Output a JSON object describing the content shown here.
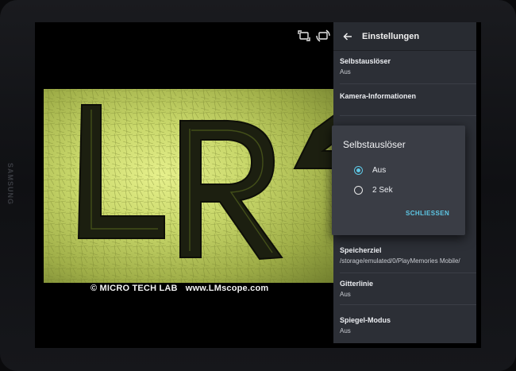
{
  "device": {
    "brand": "SAMSUNG"
  },
  "caption": {
    "copyright": "©  MICRO TECH LAB",
    "url": "www.LMscope.com"
  },
  "camera_controls": [
    {
      "name": "rotate-camera-icon"
    },
    {
      "name": "switch-camera-icon"
    }
  ],
  "settings": {
    "title": "Einstellungen",
    "items": [
      {
        "title": "Selbstauslöser",
        "value": "Aus"
      },
      {
        "title": "Kamera-Informationen",
        "value": ""
      },
      {
        "title": "Speicherziel",
        "value": "/storage/emulated/0/PlayMemories Mobile/"
      },
      {
        "title": "Gitterlinie",
        "value": "Aus"
      },
      {
        "title": "Spiegel-Modus",
        "value": "Aus"
      }
    ]
  },
  "dialog": {
    "title": "Selbstauslöser",
    "options": [
      {
        "label": "Aus",
        "selected": true
      },
      {
        "label": "2 Sek",
        "selected": false
      }
    ],
    "close_label": "SCHLIESSEN"
  },
  "colors": {
    "accent": "#5ec8e6",
    "panel": "#2c2f36",
    "dialog": "#3a3d45"
  }
}
